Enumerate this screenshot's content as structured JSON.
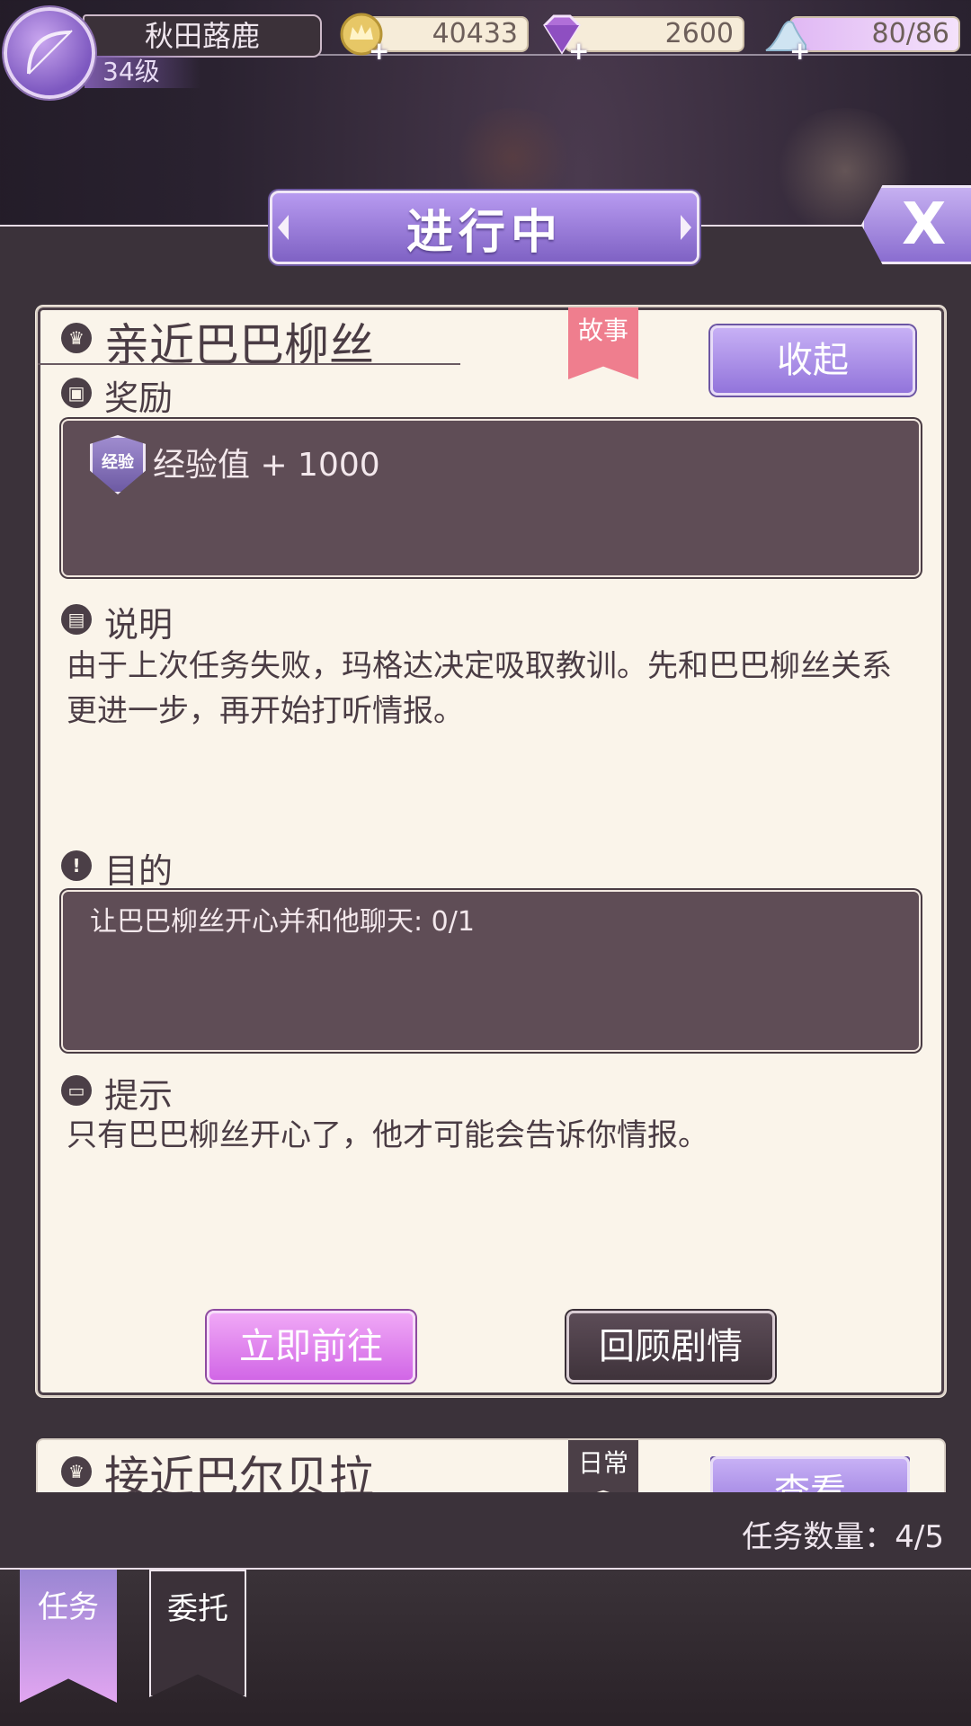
{
  "player": {
    "name": "秋田蕗鹿",
    "level": "34级"
  },
  "resources": {
    "gold": "40433",
    "gems": "2600",
    "stamina": "80/86"
  },
  "header": {
    "title": "进行中",
    "close_label": "X"
  },
  "quest": {
    "title": "亲近巴巴柳丝",
    "category": "故事",
    "collapse_label": "收起",
    "reward_heading": "奖励",
    "reward_badge": "经验",
    "reward_text": "经验值 + 1000",
    "description_heading": "说明",
    "description": "由于上次任务失败，玛格达决定吸取教训。先和巴巴柳丝关系更进一步，再开始打听情报。",
    "objective_heading": "目的",
    "objective": "让巴巴柳丝开心并和他聊天: 0/1",
    "hint_heading": "提示",
    "hint": "只有巴巴柳丝开心了，他才可能会告诉你情报。",
    "go_label": "立即前往",
    "review_label": "回顾剧情"
  },
  "quest2": {
    "title": "接近巴尔贝拉",
    "category": "日常",
    "view_label": "查看"
  },
  "footer": {
    "count_text": "任务数量：4/5"
  },
  "tabs": [
    {
      "label": "任务"
    },
    {
      "label": "委托"
    }
  ]
}
